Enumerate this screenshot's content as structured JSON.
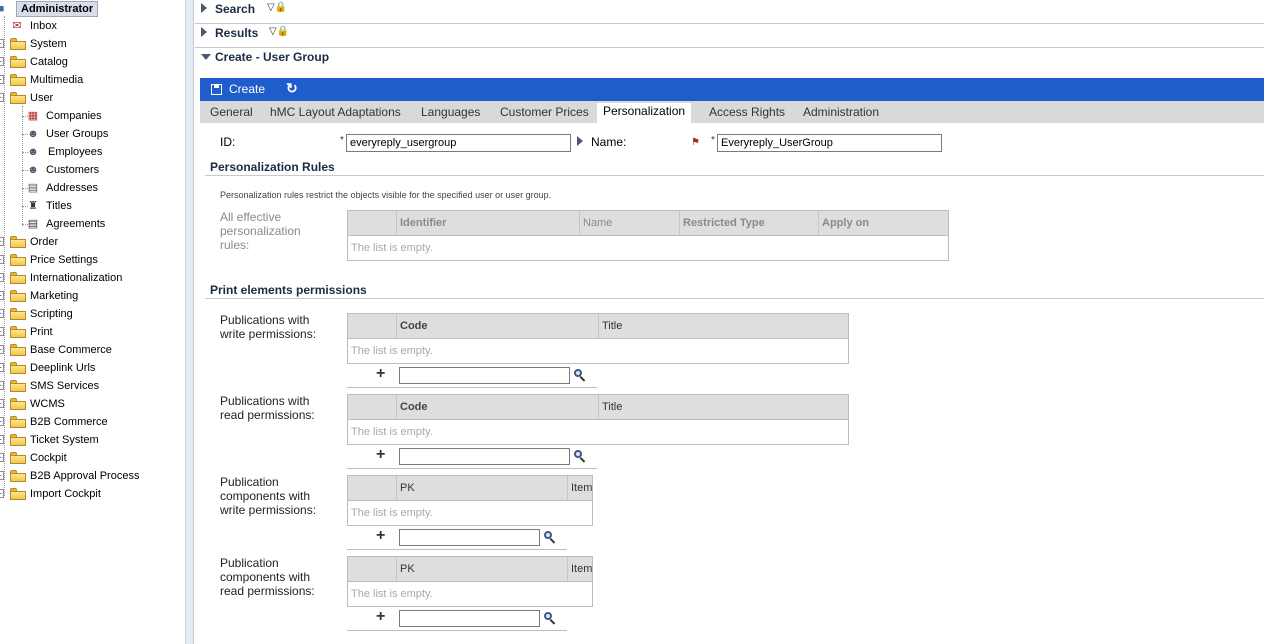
{
  "sidebar": {
    "root_label": "Administrator",
    "items": [
      {
        "label": "Inbox",
        "icon": "inbox-icon"
      },
      {
        "label": "System",
        "icon": "folder-icon"
      },
      {
        "label": "Catalog",
        "icon": "folder-icon"
      },
      {
        "label": "Multimedia",
        "icon": "folder-icon"
      },
      {
        "label": "User",
        "icon": "folder-open-icon"
      },
      {
        "label": "Companies",
        "icon": "company-icon"
      },
      {
        "label": "User Groups",
        "icon": "user-group-icon"
      },
      {
        "label": "Employees",
        "icon": "employee-icon"
      },
      {
        "label": "Customers",
        "icon": "customer-icon"
      },
      {
        "label": "Addresses",
        "icon": "address-icon"
      },
      {
        "label": "Titles",
        "icon": "title-icon"
      },
      {
        "label": "Agreements",
        "icon": "agreement-icon"
      },
      {
        "label": "Order",
        "icon": "folder-icon"
      },
      {
        "label": "Price Settings",
        "icon": "folder-icon"
      },
      {
        "label": "Internationalization",
        "icon": "folder-icon"
      },
      {
        "label": "Marketing",
        "icon": "folder-icon"
      },
      {
        "label": "Scripting",
        "icon": "folder-icon"
      },
      {
        "label": "Print",
        "icon": "folder-icon"
      },
      {
        "label": "Base Commerce",
        "icon": "folder-icon"
      },
      {
        "label": "Deeplink Urls",
        "icon": "folder-icon"
      },
      {
        "label": "SMS Services",
        "icon": "folder-icon"
      },
      {
        "label": "WCMS",
        "icon": "folder-icon"
      },
      {
        "label": "B2B Commerce",
        "icon": "folder-icon"
      },
      {
        "label": "Ticket System",
        "icon": "folder-icon"
      },
      {
        "label": "Cockpit",
        "icon": "folder-icon"
      },
      {
        "label": "B2B Approval Process",
        "icon": "folder-icon"
      },
      {
        "label": "Import Cockpit",
        "icon": "folder-icon"
      }
    ]
  },
  "sections": {
    "search": "Search",
    "results": "Results",
    "create": "Create - User Group"
  },
  "create_bar": {
    "label": "Create"
  },
  "tabs": [
    "General",
    "hMC Layout Adaptations",
    "Languages",
    "Customer Prices",
    "Personalization",
    "Access Rights",
    "Administration"
  ],
  "active_tab": "Personalization",
  "form": {
    "id_label": "ID:",
    "id_value": "everyreply_usergroup",
    "name_label": "Name:",
    "name_value": "Everyreply_UserGroup",
    "required_mark": "*"
  },
  "personalization": {
    "title": "Personalization Rules",
    "description": "Personalization rules restrict the objects visible for the specified user or user group.",
    "rules_label": "All effective personalization rules:",
    "columns": [
      "Identifier",
      "Name",
      "Restricted Type",
      "Apply on"
    ],
    "empty_text": "The list is empty."
  },
  "print_permissions": {
    "title": "Print elements permissions",
    "empty_text": "The list is empty.",
    "add_symbol": "+",
    "groups": [
      {
        "label": "Publications with write permissions:",
        "columns": [
          "Code",
          "Title"
        ]
      },
      {
        "label": "Publications with read permissions:",
        "columns": [
          "Code",
          "Title"
        ]
      },
      {
        "label": "Publication components with write permissions:",
        "columns": [
          "PK",
          "Item"
        ]
      },
      {
        "label": "Publication components with read permissions:",
        "columns": [
          "PK",
          "Item"
        ]
      }
    ]
  },
  "colors": {
    "create_bar": "#1f5ccc",
    "tab_strip": "#d9d9d9",
    "section_title": "#1b2b44"
  }
}
